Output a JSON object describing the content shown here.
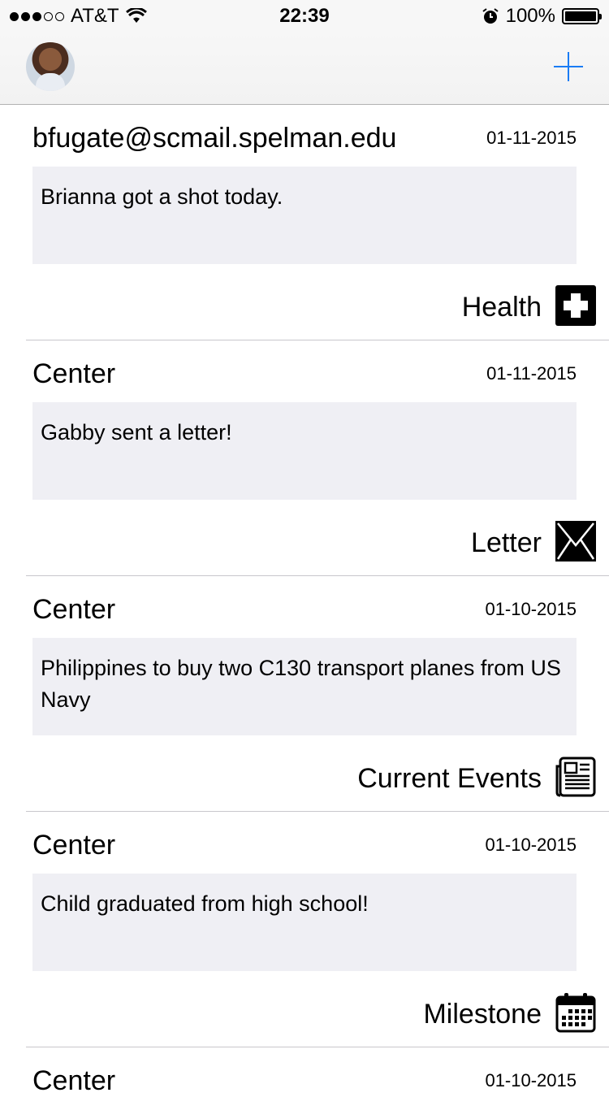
{
  "status_bar": {
    "carrier": "AT&T",
    "time": "22:39",
    "battery": "100%",
    "signal_bars_filled": 3,
    "signal_bars_total": 5
  },
  "nav": {
    "add_icon": "plus-icon",
    "accent_color": "#1a7cf5"
  },
  "entries": [
    {
      "author": "bfugate@scmail.spelman.edu",
      "date": "01-11-2015",
      "note": "Brianna got a shot today.",
      "category": "Health",
      "icon": "health-cross-icon"
    },
    {
      "author": "Center",
      "date": "01-11-2015",
      "note": "Gabby sent a letter!",
      "category": "Letter",
      "icon": "envelope-icon"
    },
    {
      "author": "Center",
      "date": "01-10-2015",
      "note": "Philippines to buy two C130 transport planes from US Navy",
      "category": "Current Events",
      "icon": "newspaper-icon"
    },
    {
      "author": "Center",
      "date": "01-10-2015",
      "note": "Child graduated from high school!",
      "category": "Milestone",
      "icon": "calendar-icon"
    },
    {
      "author": "Center",
      "date": "01-10-2015"
    }
  ]
}
